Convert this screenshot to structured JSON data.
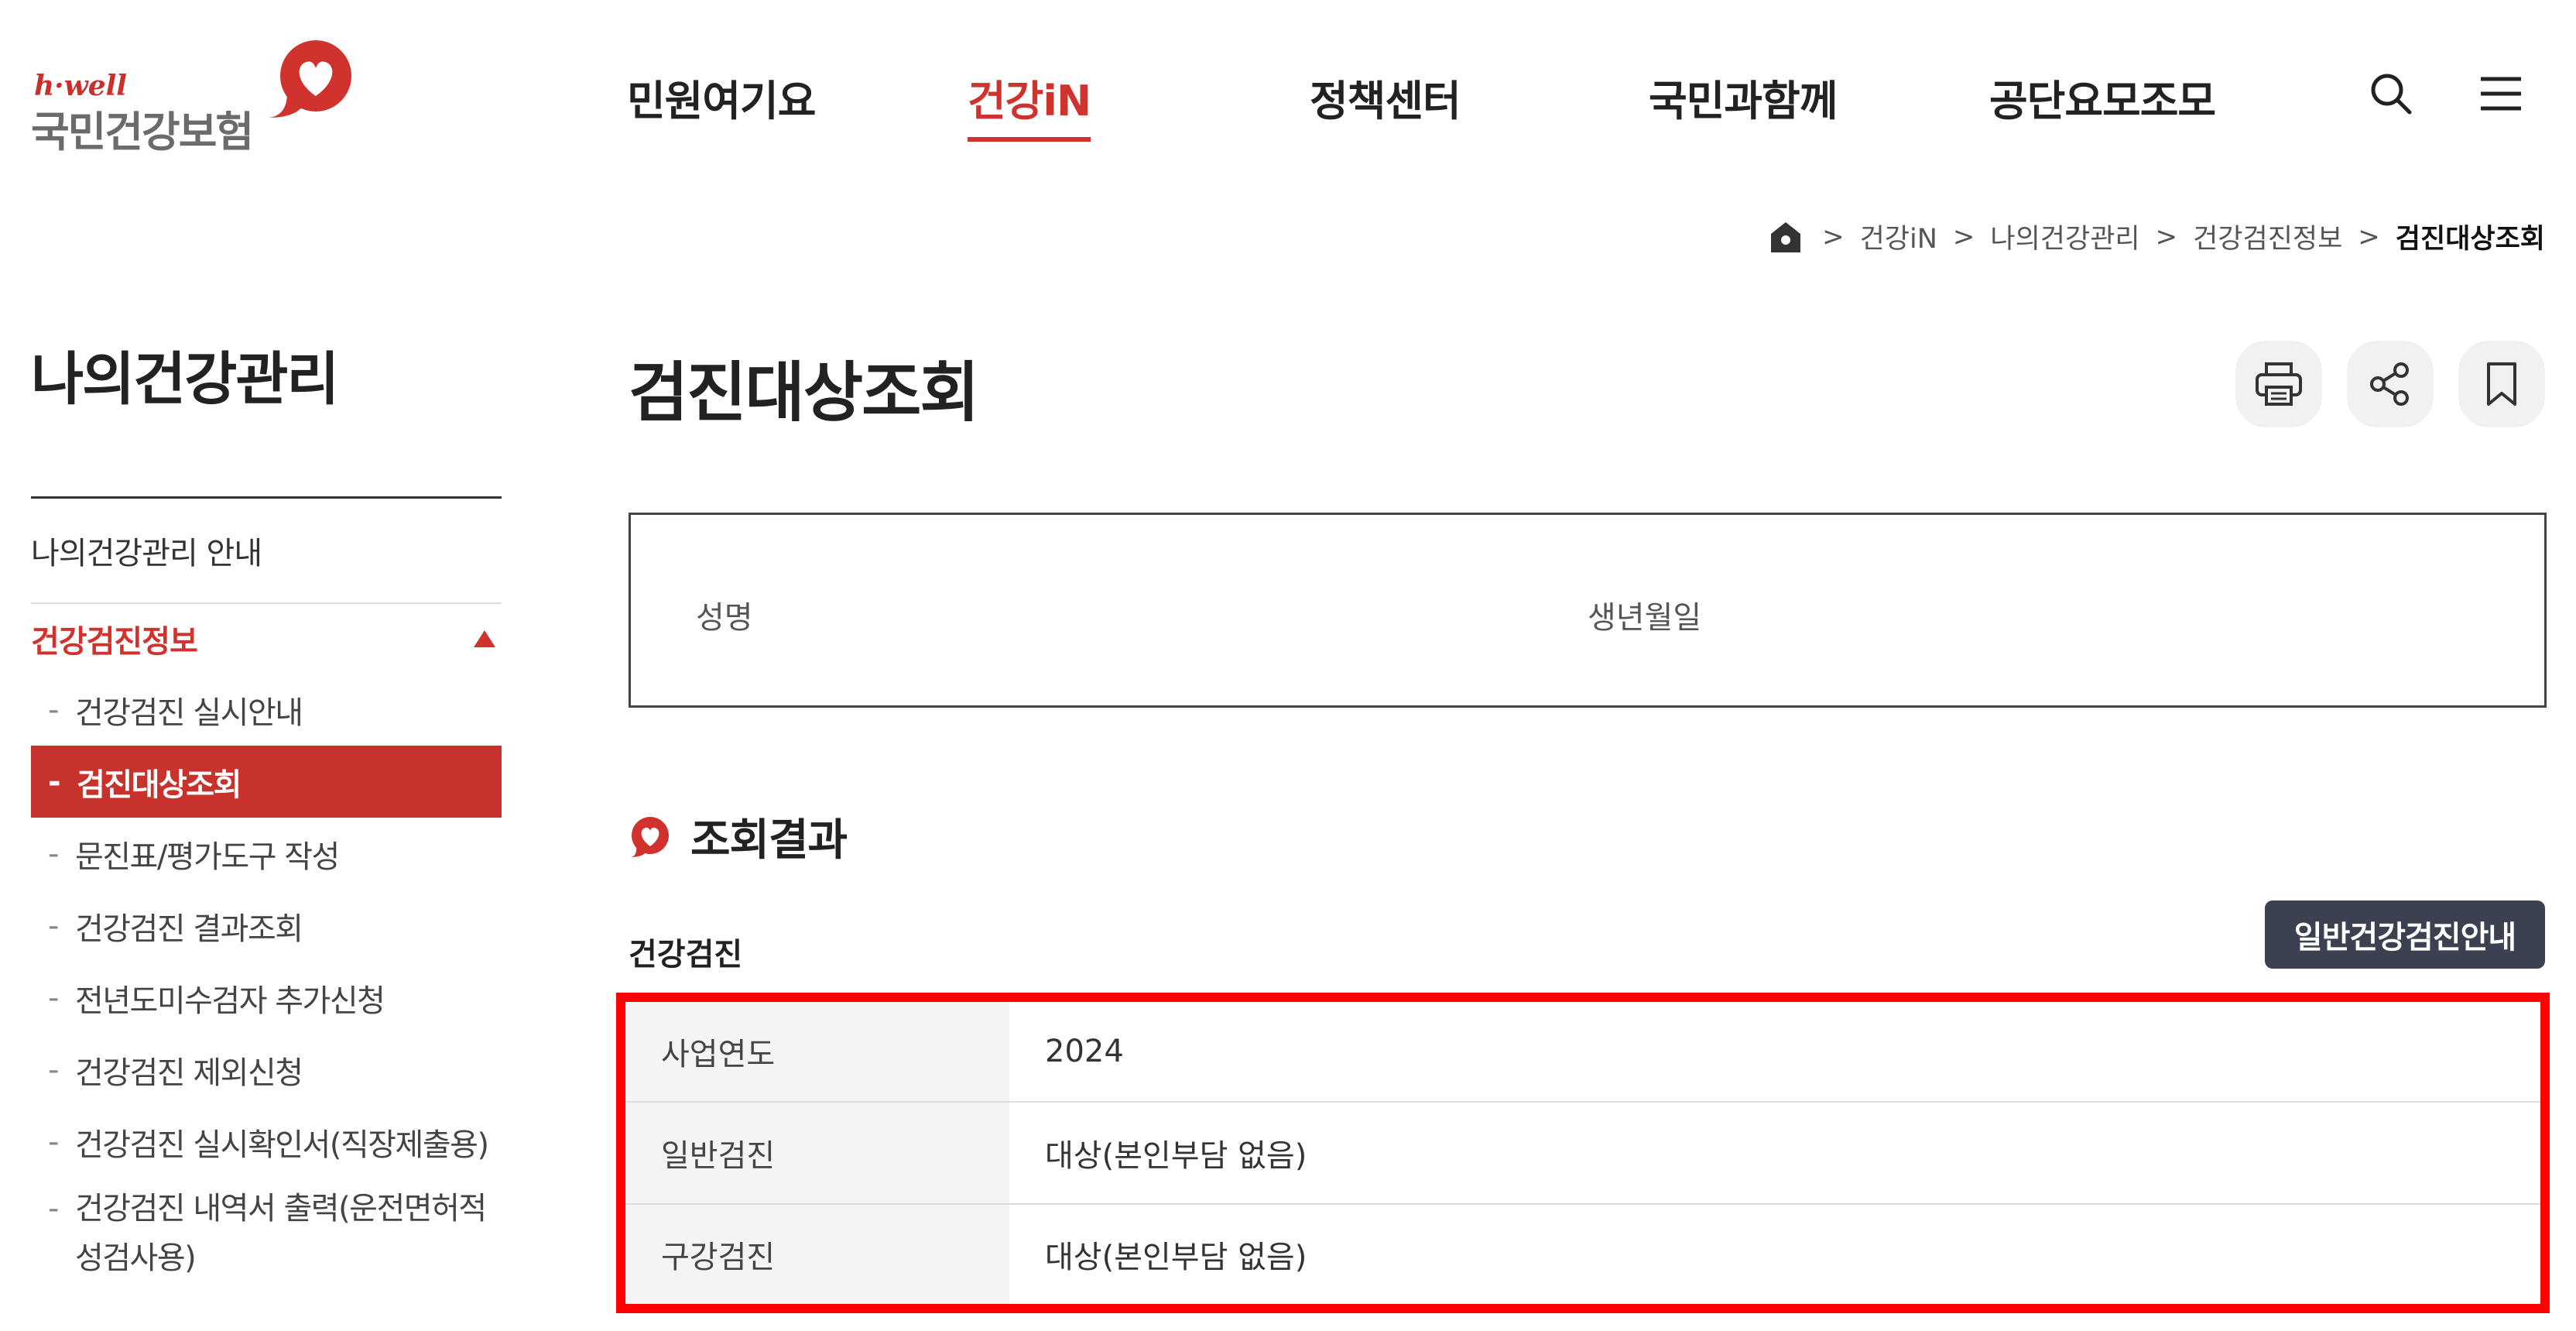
{
  "header": {
    "logo_en": "h·well",
    "logo_ko": "국민건강보험",
    "brand_color": "#d0322d",
    "nav": [
      {
        "label": "민원여기요",
        "active": false
      },
      {
        "label": "건강iN",
        "active": true
      },
      {
        "label": "정책센터",
        "active": false
      },
      {
        "label": "국민과함께",
        "active": false
      },
      {
        "label": "공단요모조모",
        "active": false
      }
    ],
    "icons": [
      "search-icon",
      "hamburger-menu-icon"
    ]
  },
  "breadcrumb": {
    "home_icon": "home-icon",
    "items": [
      "건강iN",
      "나의건강관리",
      "건강검진정보",
      "검진대상조회"
    ]
  },
  "sidebar": {
    "title": "나의건강관리",
    "items": [
      {
        "label": "나의건강관리 안내"
      },
      {
        "label": "건강검진정보",
        "active": true,
        "expanded": true
      }
    ],
    "sub_items": [
      {
        "label": "건강검진 실시안내"
      },
      {
        "label": "검진대상조회",
        "active": true
      },
      {
        "label": "문진표/평가도구 작성"
      },
      {
        "label": "건강검진 결과조회"
      },
      {
        "label": "전년도미수검자 추가신청"
      },
      {
        "label": "건강검진 제외신청"
      },
      {
        "label": "건강검진 실시확인서(직장제출용)"
      },
      {
        "label": "건강검진 내역서 출력(운전면허적성검사용)"
      }
    ],
    "dash": "-"
  },
  "main": {
    "title": "검진대상조회",
    "tools": [
      "print-icon",
      "share-icon",
      "bookmark-icon"
    ],
    "info": {
      "name_label": "성명",
      "birth_label": "생년월일"
    },
    "result_title": "조회결과",
    "section_title": "건강검진",
    "guide_button": "일반건강검진안내",
    "rows": [
      {
        "label": "사업연도",
        "value": "2024"
      },
      {
        "label": "일반검진",
        "value": "대상(본인부담 없음)"
      },
      {
        "label": "구강검진",
        "value": "대상(본인부담 없음)"
      }
    ],
    "highlight_color": "#ff0000"
  }
}
